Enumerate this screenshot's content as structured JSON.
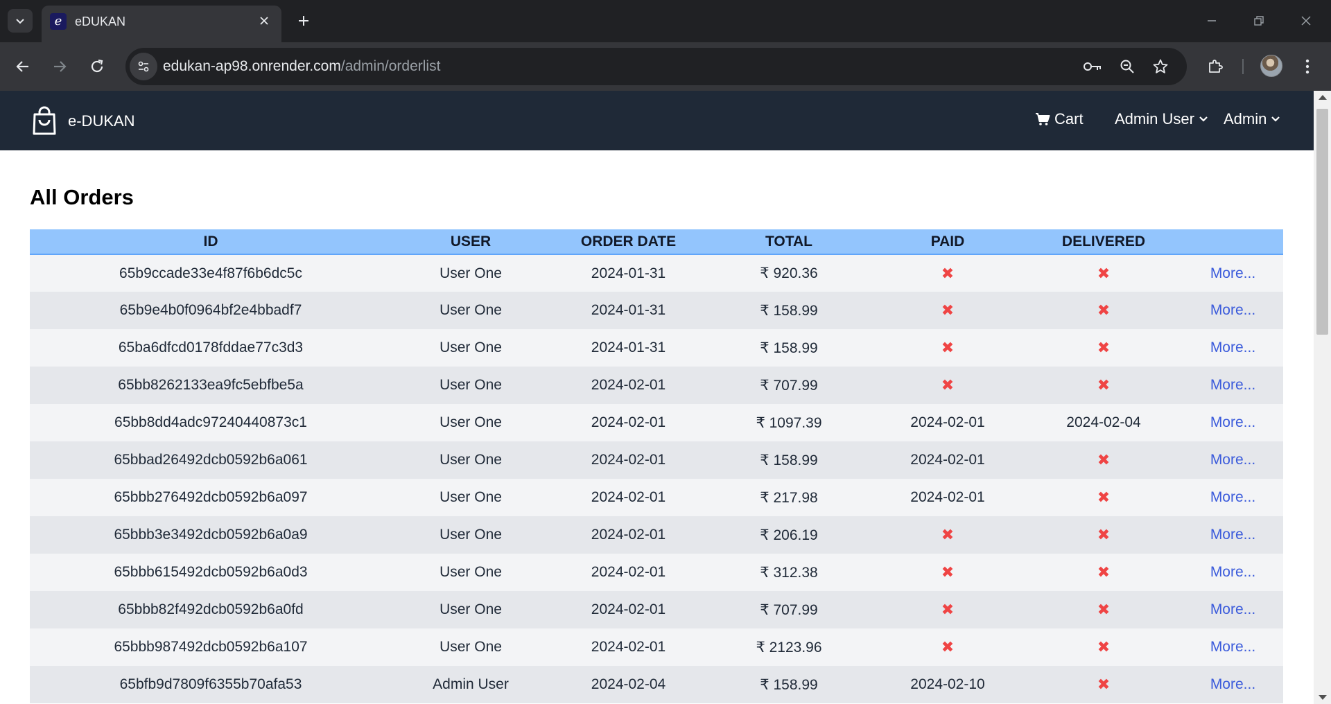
{
  "browser": {
    "tab_title": "eDUKAN",
    "favicon_letter": "e",
    "url_host": "edukan-ap98.onrender.com",
    "url_path": "/admin/orderlist"
  },
  "navbar": {
    "brand": "e-DUKAN",
    "cart_label": "Cart",
    "user_menu_label": "Admin User",
    "admin_menu_label": "Admin"
  },
  "page": {
    "title": "All Orders"
  },
  "table": {
    "headers": [
      "ID",
      "USER",
      "ORDER DATE",
      "TOTAL",
      "PAID",
      "DELIVERED",
      ""
    ],
    "rows": [
      {
        "id": "65b9ccade33e4f87f6b6dc5c",
        "user": "User One",
        "date": "2024-01-31",
        "total": "₹ 920.36",
        "paid": "✖",
        "delivered": "✖",
        "action": "More..."
      },
      {
        "id": "65b9e4b0f0964bf2e4bbadf7",
        "user": "User One",
        "date": "2024-01-31",
        "total": "₹ 158.99",
        "paid": "✖",
        "delivered": "✖",
        "action": "More..."
      },
      {
        "id": "65ba6dfcd0178fddae77c3d3",
        "user": "User One",
        "date": "2024-01-31",
        "total": "₹ 158.99",
        "paid": "✖",
        "delivered": "✖",
        "action": "More..."
      },
      {
        "id": "65bb8262133ea9fc5ebfbe5a",
        "user": "User One",
        "date": "2024-02-01",
        "total": "₹ 707.99",
        "paid": "✖",
        "delivered": "✖",
        "action": "More..."
      },
      {
        "id": "65bb8dd4adc97240440873c1",
        "user": "User One",
        "date": "2024-02-01",
        "total": "₹ 1097.39",
        "paid": "2024-02-01",
        "delivered": "2024-02-04",
        "action": "More..."
      },
      {
        "id": "65bbad26492dcb0592b6a061",
        "user": "User One",
        "date": "2024-02-01",
        "total": "₹ 158.99",
        "paid": "2024-02-01",
        "delivered": "✖",
        "action": "More..."
      },
      {
        "id": "65bbb276492dcb0592b6a097",
        "user": "User One",
        "date": "2024-02-01",
        "total": "₹ 217.98",
        "paid": "2024-02-01",
        "delivered": "✖",
        "action": "More..."
      },
      {
        "id": "65bbb3e3492dcb0592b6a0a9",
        "user": "User One",
        "date": "2024-02-01",
        "total": "₹ 206.19",
        "paid": "✖",
        "delivered": "✖",
        "action": "More..."
      },
      {
        "id": "65bbb615492dcb0592b6a0d3",
        "user": "User One",
        "date": "2024-02-01",
        "total": "₹ 312.38",
        "paid": "✖",
        "delivered": "✖",
        "action": "More..."
      },
      {
        "id": "65bbb82f492dcb0592b6a0fd",
        "user": "User One",
        "date": "2024-02-01",
        "total": "₹ 707.99",
        "paid": "✖",
        "delivered": "✖",
        "action": "More..."
      },
      {
        "id": "65bbb987492dcb0592b6a107",
        "user": "User One",
        "date": "2024-02-01",
        "total": "₹ 2123.96",
        "paid": "✖",
        "delivered": "✖",
        "action": "More..."
      },
      {
        "id": "65bfb9d7809f6355b70afa53",
        "user": "Admin User",
        "date": "2024-02-04",
        "total": "₹ 158.99",
        "paid": "2024-02-10",
        "delivered": "✖",
        "action": "More..."
      }
    ]
  },
  "colors": {
    "navbar_bg": "#1f2937",
    "header_bg": "#93c5fd",
    "cross_color": "#ef4444",
    "link_color": "#3b5bdb"
  }
}
